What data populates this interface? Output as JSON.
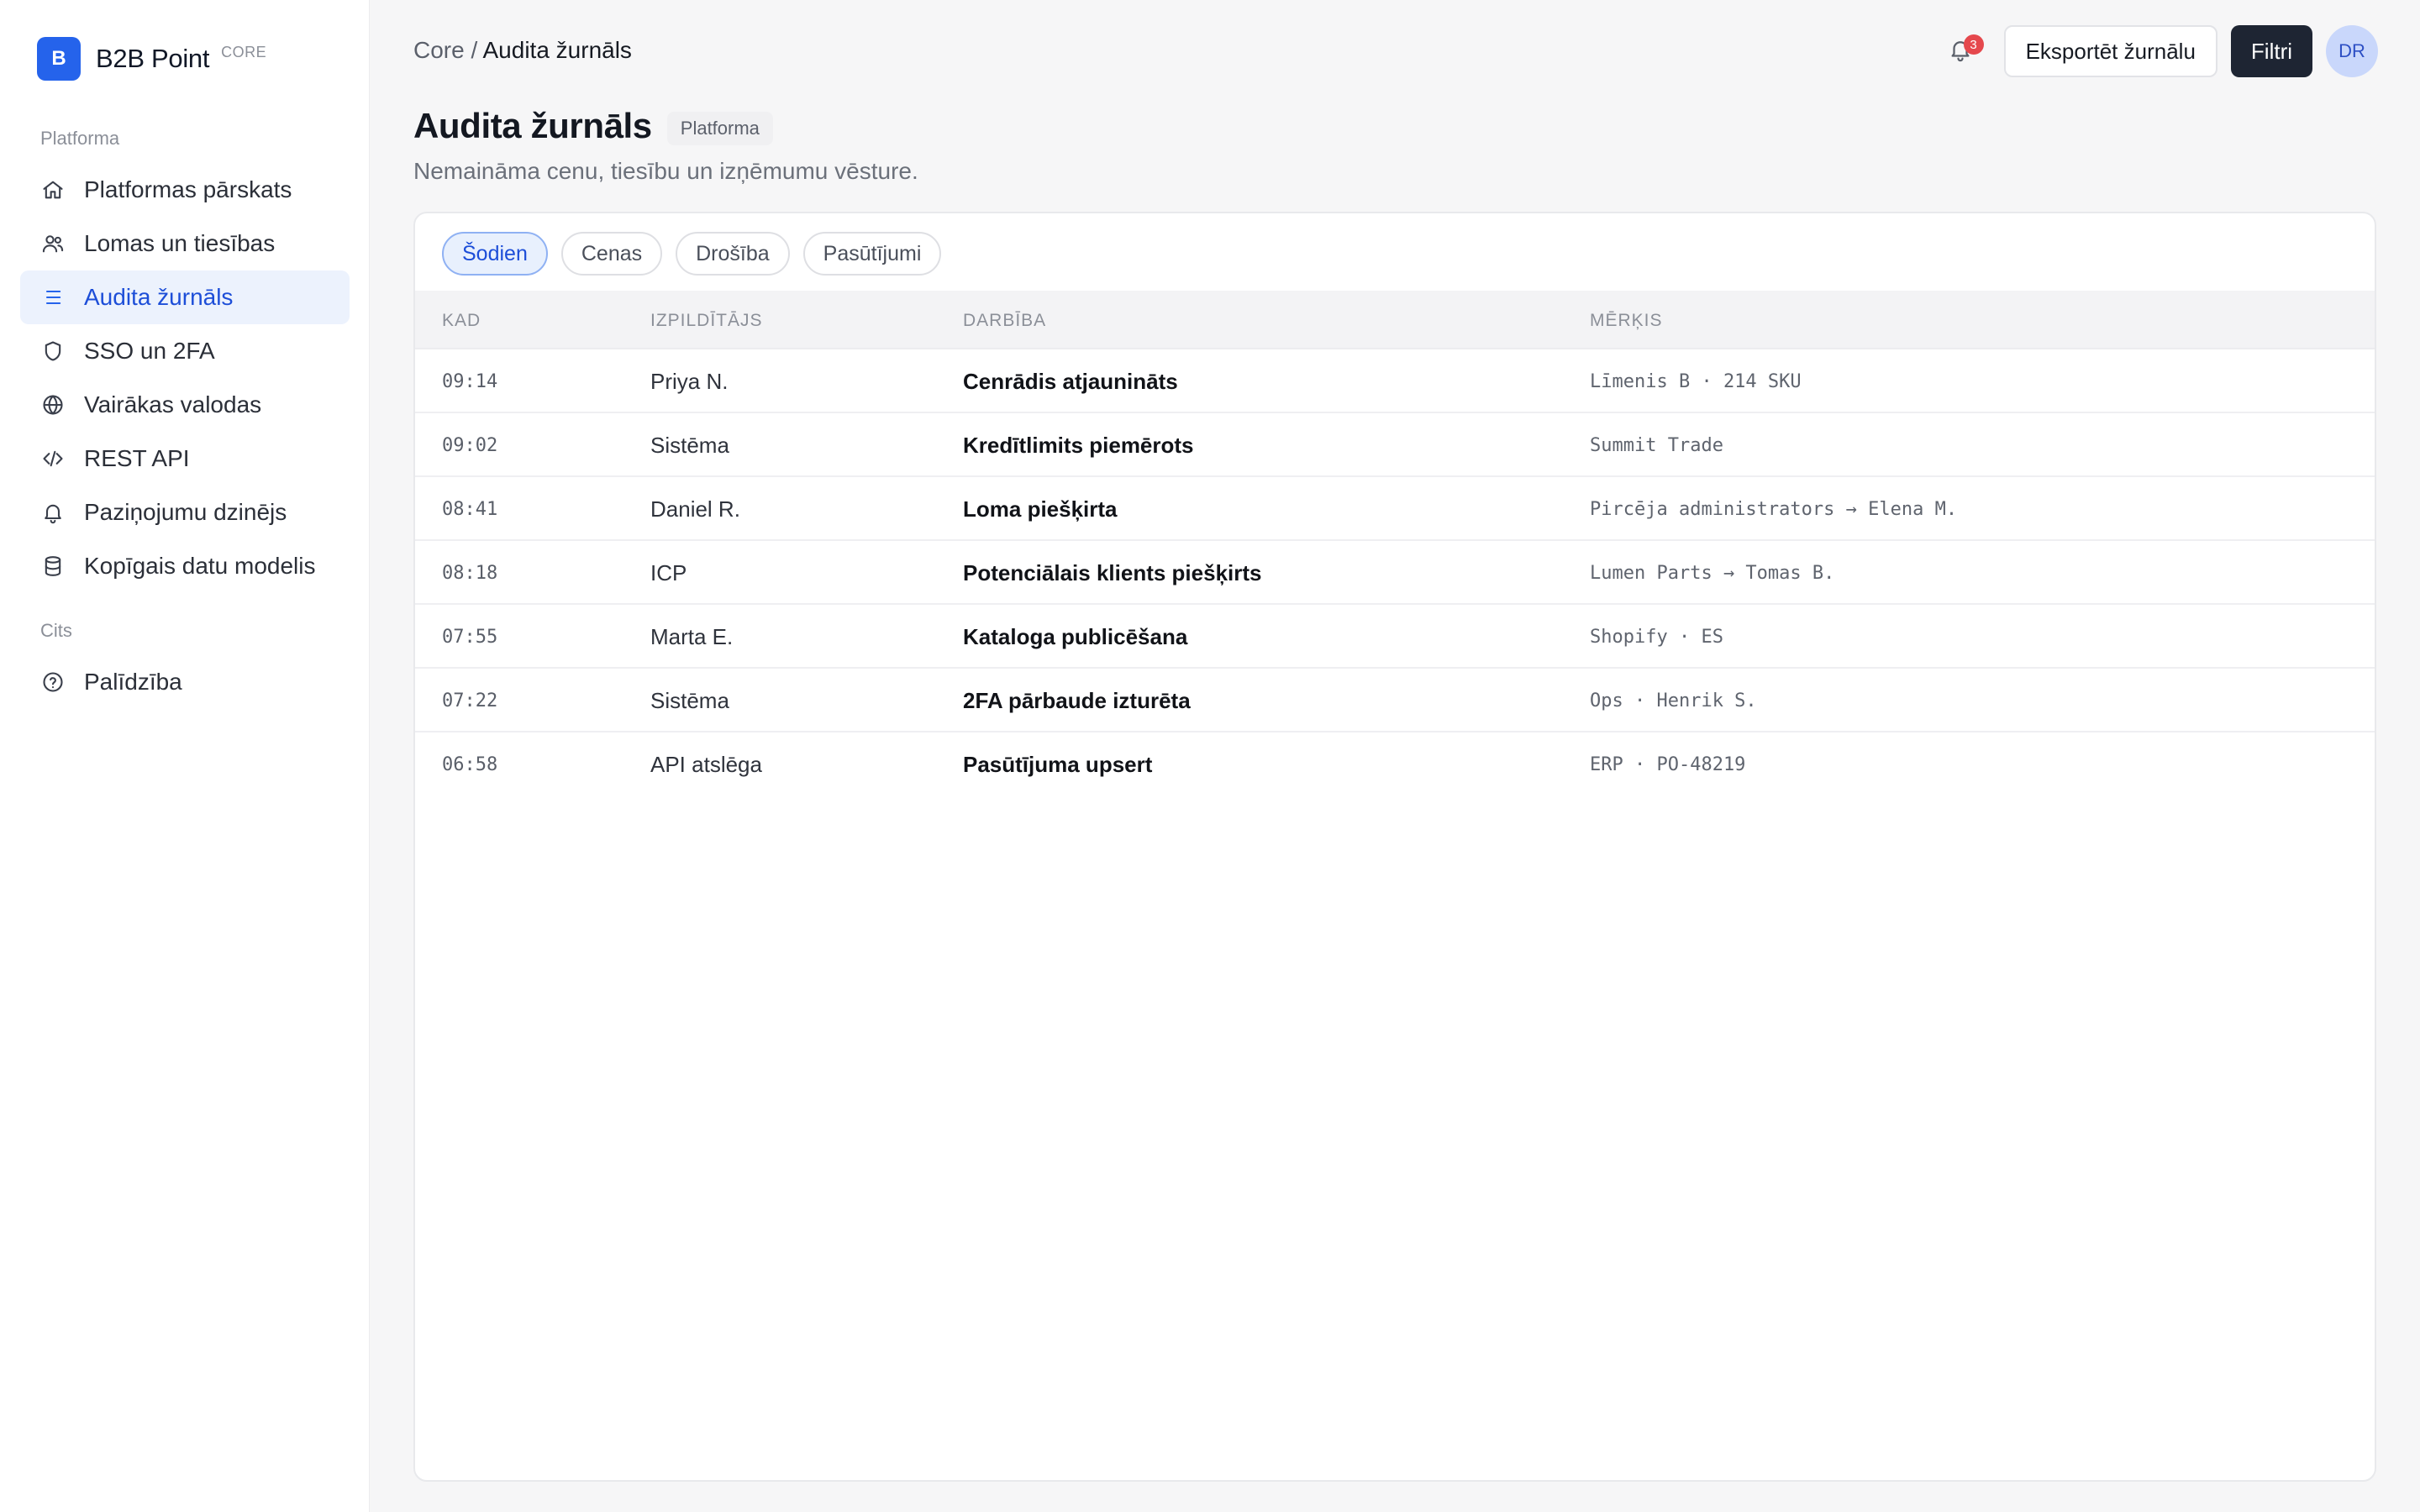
{
  "brand": {
    "logo_letter": "B",
    "name": "B2B Point",
    "tag": "CORE",
    "color": "#2563eb"
  },
  "sidebar": {
    "sections": [
      {
        "label": "Platforma",
        "items": [
          {
            "label": "Platformas pārskats",
            "icon": "home-icon",
            "active": false
          },
          {
            "label": "Lomas un tiesības",
            "icon": "users-icon",
            "active": false
          },
          {
            "label": "Audita žurnāls",
            "icon": "list-icon",
            "active": true
          },
          {
            "label": "SSO un 2FA",
            "icon": "shield-icon",
            "active": false
          },
          {
            "label": "Vairākas valodas",
            "icon": "globe-icon",
            "active": false
          },
          {
            "label": "REST API",
            "icon": "code-icon",
            "active": false
          },
          {
            "label": "Paziņojumu dzinējs",
            "icon": "bell-icon",
            "active": false
          },
          {
            "label": "Kopīgais datu modelis",
            "icon": "database-icon",
            "active": false
          }
        ]
      },
      {
        "label": "Cits",
        "items": [
          {
            "label": "Palīdzība",
            "icon": "help-circle-icon",
            "active": false
          }
        ]
      }
    ]
  },
  "header": {
    "breadcrumb_root": "Core",
    "breadcrumb_sep": "/",
    "breadcrumb_current": "Audita žurnāls",
    "notifications_count": "3",
    "export_label": "Eksportēt žurnālu",
    "filter_label": "Filtri",
    "avatar_initials": "DR"
  },
  "page": {
    "title": "Audita žurnāls",
    "scope_badge": "Platforma",
    "subtitle": "Nemaināma cenu, tiesību un izņēmumu vēsture."
  },
  "filters": {
    "chips": [
      {
        "label": "Šodien",
        "active": true
      },
      {
        "label": "Cenas",
        "active": false
      },
      {
        "label": "Drošība",
        "active": false
      },
      {
        "label": "Pasūtījumi",
        "active": false
      }
    ]
  },
  "table": {
    "columns": {
      "time": "KAD",
      "actor": "IZPILDĪTĀJS",
      "action": "DARBĪBA",
      "target": "MĒRĶIS"
    },
    "rows": [
      {
        "time": "09:14",
        "actor": "Priya N.",
        "action": "Cenrādis atjaunināts",
        "target": "Līmenis B · 214 SKU"
      },
      {
        "time": "09:02",
        "actor": "Sistēma",
        "action": "Kredītlimits piemērots",
        "target": "Summit Trade"
      },
      {
        "time": "08:41",
        "actor": "Daniel R.",
        "action": "Loma piešķirta",
        "target": "Pircēja administrators → Elena M."
      },
      {
        "time": "08:18",
        "actor": "ICP",
        "action": "Potenciālais klients piešķirts",
        "target": "Lumen Parts → Tomas B."
      },
      {
        "time": "07:55",
        "actor": "Marta E.",
        "action": "Kataloga publicēšana",
        "target": "Shopify · ES"
      },
      {
        "time": "07:22",
        "actor": "Sistēma",
        "action": "2FA pārbaude izturēta",
        "target": "Ops · Henrik S."
      },
      {
        "time": "06:58",
        "actor": "API atslēga",
        "action": "Pasūtījuma upsert",
        "target": "ERP · PO-48219"
      }
    ]
  }
}
